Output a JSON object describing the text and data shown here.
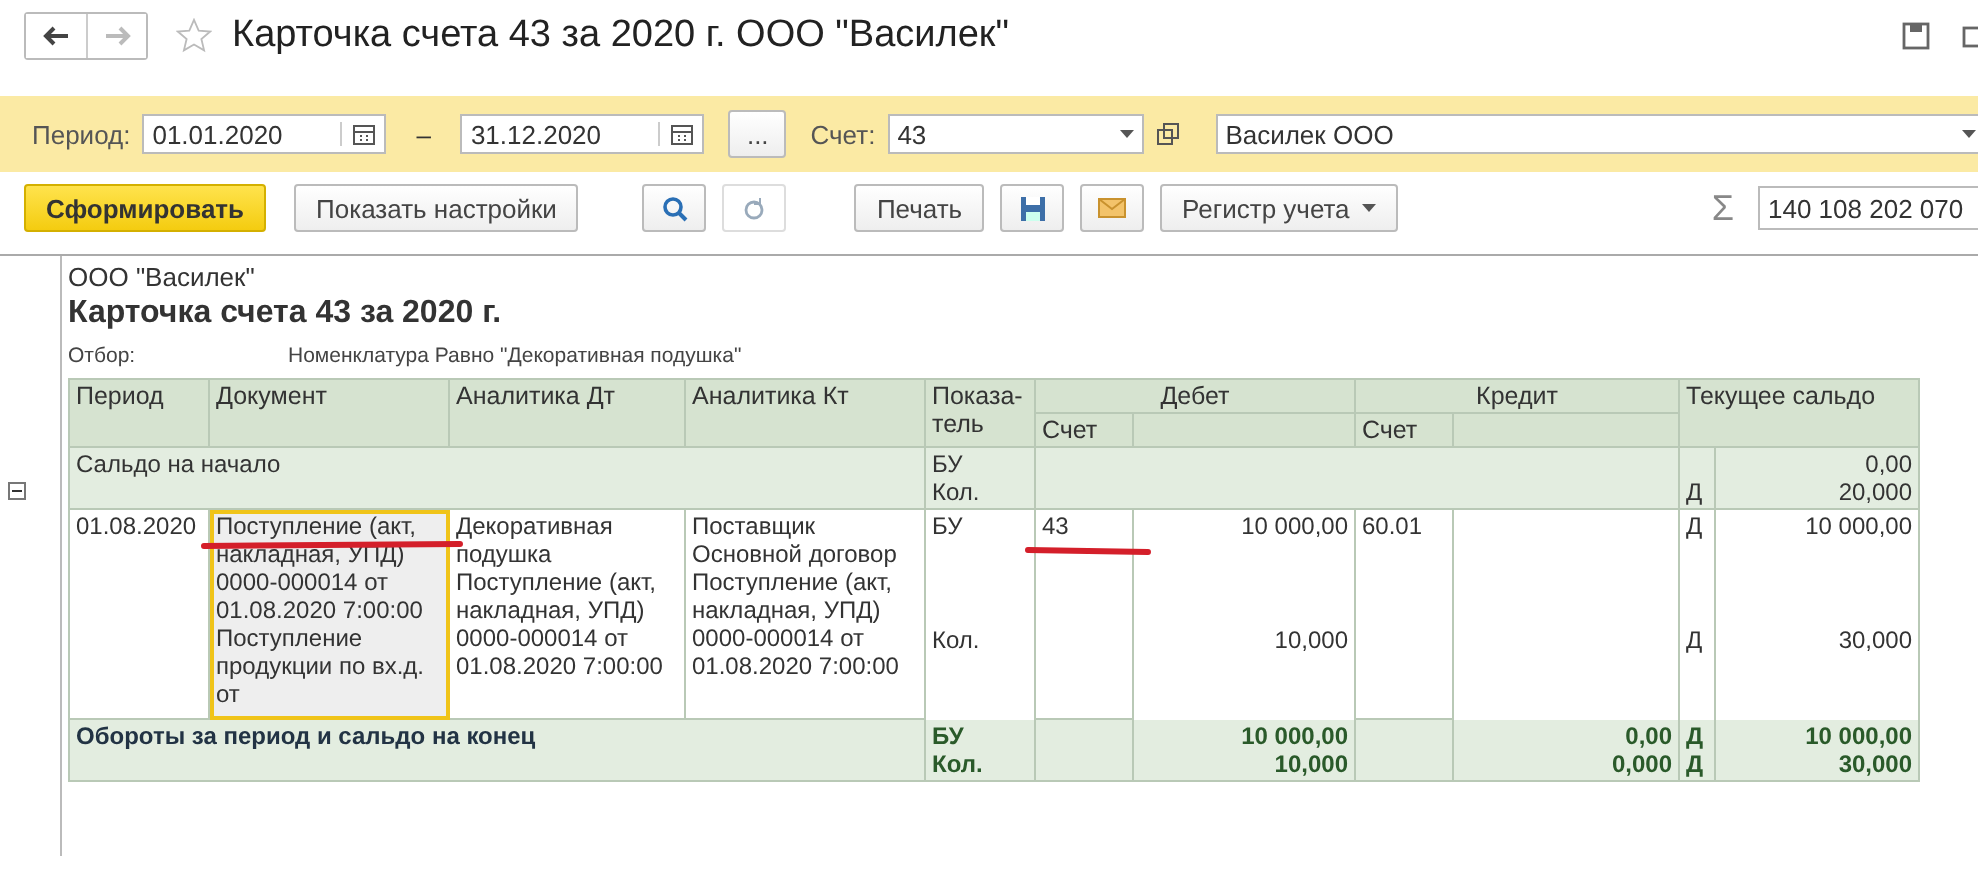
{
  "window": {
    "title": "Карточка счета 43 за 2020 г. ООО \"Василек\""
  },
  "filters": {
    "period_label": "Период:",
    "date_from": "01.01.2020",
    "dash": "–",
    "date_to": "31.12.2020",
    "more": "...",
    "account_label": "Счет:",
    "account": "43",
    "organization": "Василек ООО"
  },
  "toolbar": [
    {
      "kind": "primary",
      "label": "Сформировать"
    },
    {
      "kind": "plain",
      "label": "Показать настройки"
    },
    {
      "kind": "search"
    },
    {
      "kind": "refresh"
    },
    {
      "kind": "plain",
      "label": "Печать"
    },
    {
      "kind": "save"
    },
    {
      "kind": "mail"
    },
    {
      "kind": "dropdown",
      "label": "Регистр учета"
    }
  ],
  "sum": {
    "symbol": "Σ",
    "value": "140 108 202 070"
  },
  "report": {
    "organization": "ООО \"Василек\"",
    "title": "Карточка счета 43 за 2020 г.",
    "filter_label": "Отбор:",
    "filter_value": "Номенклатура Равно \"Декоративная подушка\"",
    "columns": [
      "Период",
      "Документ",
      "Аналитика Дт",
      "Аналитика Кт",
      "Показа-тель",
      "Дебет",
      "Кредит",
      "Текущее сальдо"
    ],
    "subcolumns": {
      "debit_account": "Счет",
      "credit_account": "Счет"
    },
    "opening": {
      "label": "Сальдо на начало",
      "indicators": [
        "БУ",
        "Кол."
      ],
      "saldo": [
        {
          "value": "0,00"
        },
        {
          "side": "Д",
          "value": "20,000"
        }
      ]
    },
    "rows": [
      {
        "period": "01.08.2020",
        "document": "Поступление (акт, накладная, УПД) 0000-000014 от 01.08.2020 7:00:00 Поступление продукции по вх.д. от",
        "document_selected": true,
        "document_marked": true,
        "analytics_dt": "Декоративная подушка Поступление (акт, накладная, УПД) 0000-000014 от 01.08.2020 7:00:00",
        "analytics_kt": "Поставщик Основной договор Поступление (акт, накладная, УПД) 0000-000014 от 01.08.2020 7:00:00",
        "debit_account": "43",
        "debit_marked": true,
        "credit_account": "60.01",
        "lines": [
          {
            "indicator": "БУ",
            "debit": "10 000,00",
            "side": "Д",
            "saldo": "10 000,00"
          },
          {
            "indicator": "Кол.",
            "debit": "10,000",
            "side": "Д",
            "saldo": "30,000"
          }
        ]
      }
    ],
    "totals": {
      "label": "Обороты за период и сальдо на конец",
      "lines": [
        {
          "indicator": "БУ",
          "debit": "10 000,00",
          "credit": "0,00",
          "side": "Д",
          "saldo": "10 000,00"
        },
        {
          "indicator": "Кол.",
          "debit": "10,000",
          "credit": "0,000",
          "side": "Д",
          "saldo": "30,000"
        }
      ]
    }
  }
}
